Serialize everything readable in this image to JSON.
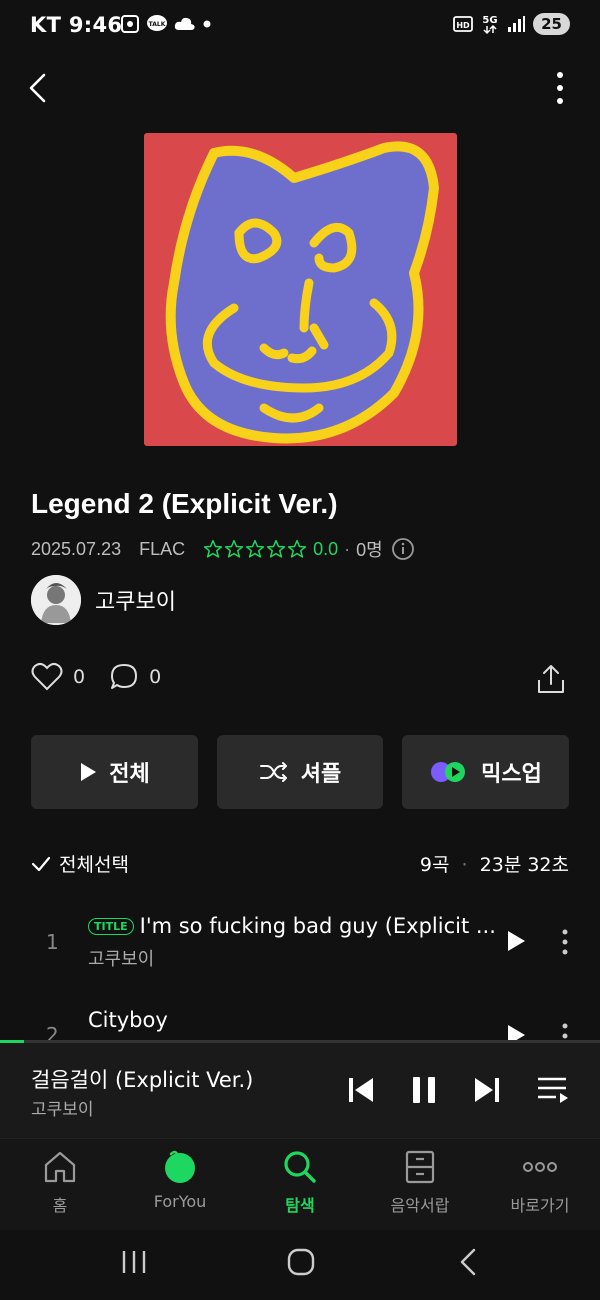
{
  "status_bar": {
    "carrier": "KT",
    "time": "9:46",
    "battery": "25"
  },
  "album": {
    "title": "Legend 2 (Explicit Ver.)",
    "release_date": "2025.07.23",
    "format": "FLAC",
    "rating": "0.0",
    "rating_count": "0명",
    "artist": "고쿠보이"
  },
  "social": {
    "likes": "0",
    "comments": "0"
  },
  "actions": {
    "play_all": "전체",
    "shuffle": "셔플",
    "mixup": "믹스업"
  },
  "list_header": {
    "select_all": "전체선택",
    "track_count": "9곡",
    "duration": "23분 32초"
  },
  "tracks": [
    {
      "number": "1",
      "badge": "TITLE",
      "title": "I'm so fucking bad guy (Explicit ...",
      "artist": "고쿠보이"
    },
    {
      "number": "2",
      "title": "Cityboy"
    }
  ],
  "now_playing": {
    "title": "걸음걸이 (Explicit Ver.)",
    "artist": "고쿠보이",
    "progress": 0.04
  },
  "bottom_nav": {
    "home": "홈",
    "foryou": "ForYou",
    "search": "탐색",
    "library": "음악서랍",
    "more": "바로가기",
    "active": "search"
  },
  "colors": {
    "accent": "#1ed760",
    "background": "#111111",
    "button_bg": "#2b2b2b",
    "art_red": "#d9484b",
    "art_purple": "#6e6ecc",
    "art_yellow": "#f8d21a"
  }
}
